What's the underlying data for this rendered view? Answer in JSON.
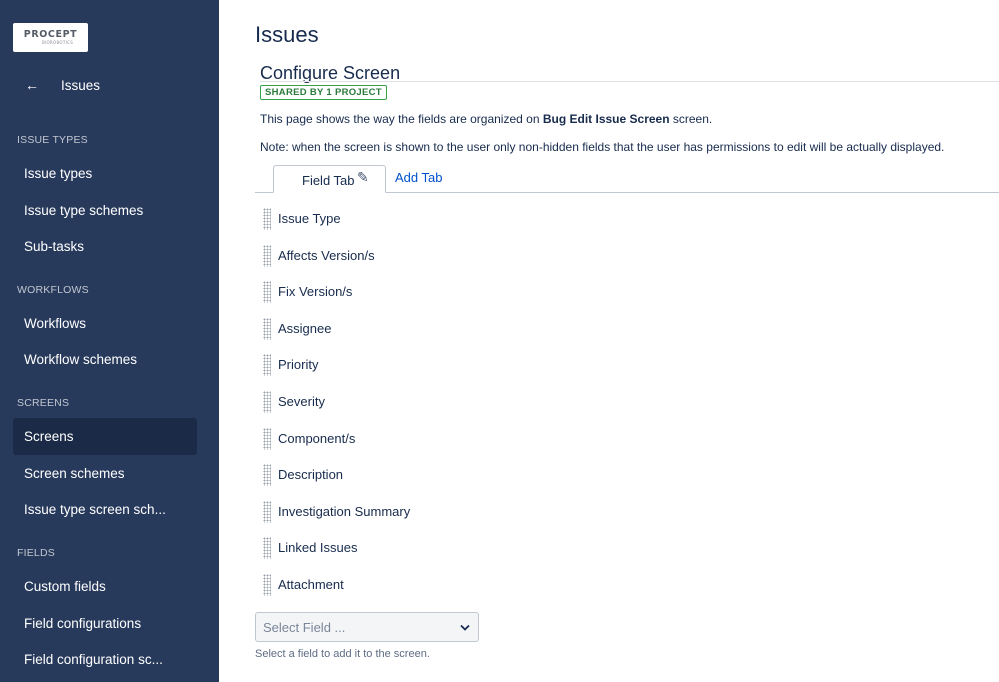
{
  "sidebar": {
    "logo": {
      "main": "PROCEPT",
      "sub": "BIOROBOTICS"
    },
    "back": {
      "icon": "arrow-left-icon",
      "label": "Issues"
    },
    "sections": [
      {
        "heading": "ISSUE TYPES",
        "items": [
          "Issue types",
          "Issue type schemes",
          "Sub-tasks"
        ]
      },
      {
        "heading": "WORKFLOWS",
        "items": [
          "Workflows",
          "Workflow schemes"
        ]
      },
      {
        "heading": "SCREENS",
        "items": [
          "Screens",
          "Screen schemes",
          "Issue type screen sch..."
        ]
      },
      {
        "heading": "FIELDS",
        "items": [
          "Custom fields",
          "Field configurations",
          "Field configuration sc..."
        ]
      }
    ],
    "active_item": "Screens",
    "colors": {
      "background": "#283a5c",
      "active": "#1a2a47"
    }
  },
  "main": {
    "page_title": "Issues",
    "section_title": "Configure Screen",
    "badge": "SHARED BY 1 PROJECT",
    "description": {
      "prefix": "This page shows the way the fields are organized on ",
      "screen_name": "Bug Edit Issue Screen",
      "suffix": " screen."
    },
    "note": "Note: when the screen is shown to the user only non-hidden fields that the user has permissions to edit will be actually displayed.",
    "tabs": {
      "active": "Field Tab",
      "active_icon": "pencil-icon",
      "add": "Add Tab"
    },
    "fields": [
      "Issue Type",
      "Affects Version/s",
      "Fix Version/s",
      "Assignee",
      "Priority",
      "Severity",
      "Component/s",
      "Description",
      "Investigation Summary",
      "Linked Issues",
      "Attachment"
    ],
    "select": {
      "placeholder": "Select Field ...",
      "hint": "Select a field to add it to the screen."
    },
    "colors": {
      "link": "#0052cc",
      "badge": "#37a14a"
    }
  }
}
